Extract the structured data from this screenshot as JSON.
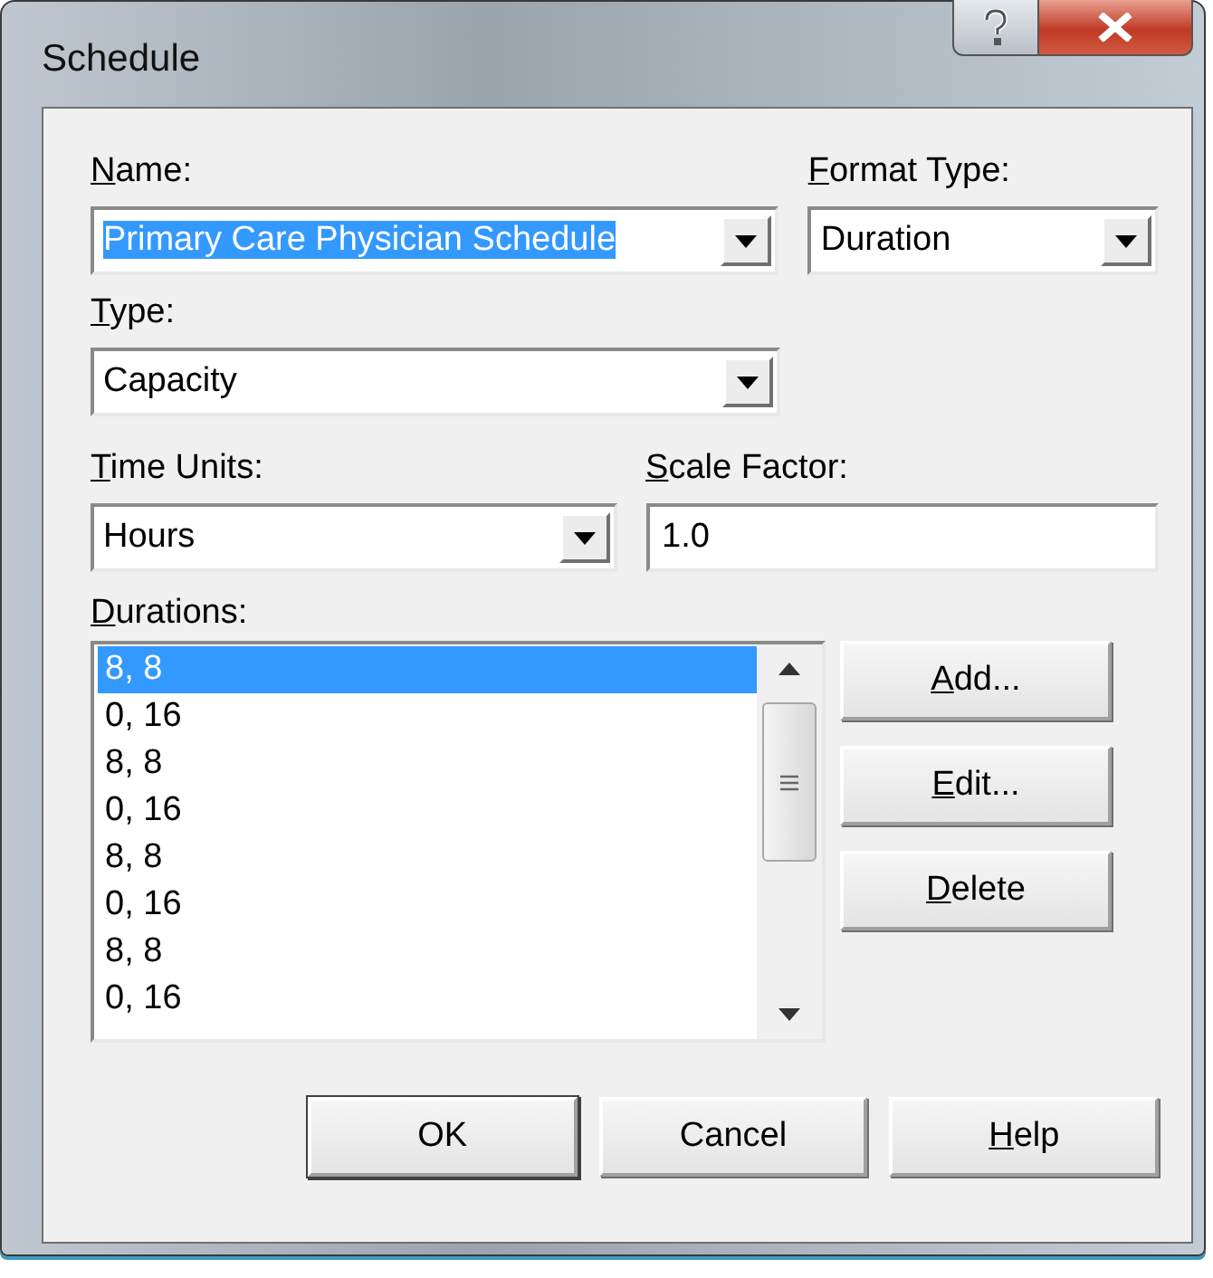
{
  "window": {
    "title": "Schedule"
  },
  "name": {
    "kind": "combo",
    "label": "Name:",
    "mnemonic": true,
    "value": "Primary Care Physician Schedule",
    "value_selected": true
  },
  "format_type": {
    "kind": "combo",
    "label": "Format Type:",
    "mnemonic": true,
    "value": "Duration",
    "value_selected": false
  },
  "type": {
    "kind": "combo",
    "label": "Type:",
    "mnemonic": true,
    "value": "Capacity",
    "value_selected": false
  },
  "time_units": {
    "kind": "combo",
    "label": "Time Units:",
    "mnemonic": true,
    "value": "Hours",
    "value_selected": false
  },
  "scale_factor": {
    "kind": "text",
    "label": "Scale Factor:",
    "mnemonic": true,
    "value": "1.0",
    "value_selected": false
  },
  "durations": {
    "label": "Durations:",
    "mnemonic": true,
    "items": [
      {
        "text": "8, 8",
        "selected": true
      },
      {
        "text": "0, 16",
        "selected": false
      },
      {
        "text": "8, 8",
        "selected": false
      },
      {
        "text": "0, 16",
        "selected": false
      },
      {
        "text": "8, 8",
        "selected": false
      },
      {
        "text": "0, 16",
        "selected": false
      },
      {
        "text": "8, 8",
        "selected": false
      },
      {
        "text": "0, 16",
        "selected": false
      }
    ]
  },
  "list_buttons": [
    {
      "label": "Add...",
      "mnemonic": true
    },
    {
      "label": "Edit...",
      "mnemonic": true
    },
    {
      "label": "Delete",
      "mnemonic": true
    }
  ],
  "dialog_buttons": [
    {
      "label": "OK",
      "mnemonic": false,
      "default": true
    },
    {
      "label": "Cancel",
      "mnemonic": false,
      "default": false
    },
    {
      "label": "Help",
      "mnemonic": true,
      "default": false
    }
  ]
}
